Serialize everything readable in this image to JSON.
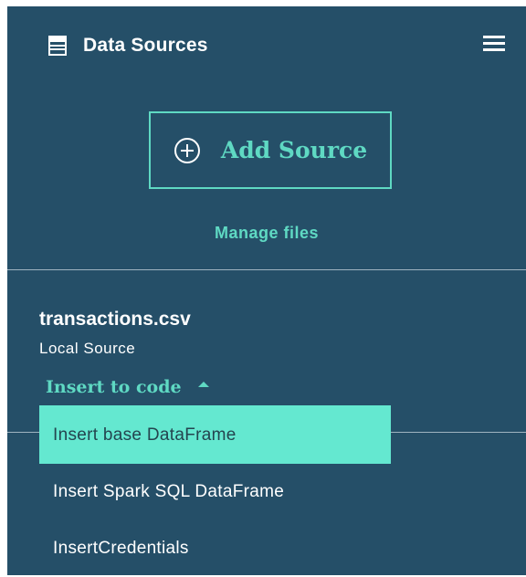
{
  "header": {
    "title": "Data Sources",
    "icon": "database-icon",
    "menu_icon": "hamburger-menu-icon"
  },
  "actions": {
    "add_source_label": "Add Source",
    "add_source_icon": "plus-circle-icon",
    "manage_files_label": "Manage files"
  },
  "file": {
    "name": "transactions.csv",
    "source_type": "Local Source",
    "insert_label": "Insert to code",
    "insert_icon": "caret-up-icon"
  },
  "dropdown": {
    "items": [
      {
        "label": "Insert base DataFrame",
        "highlighted": true
      },
      {
        "label": "Insert Spark SQL DataFrame",
        "highlighted": false
      },
      {
        "label": "InsertCredentials",
        "highlighted": false
      }
    ]
  },
  "colors": {
    "panel_bg": "#254f68",
    "accent": "#5fd9c3",
    "highlight_bg": "#64e8d0",
    "text": "#ffffff"
  }
}
